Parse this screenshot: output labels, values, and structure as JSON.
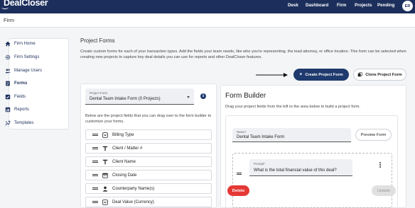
{
  "app": {
    "logo_text": "DealCloser"
  },
  "nav": {
    "items": [
      {
        "label": "Desk"
      },
      {
        "label": "Dashboard"
      },
      {
        "label": "Firm"
      },
      {
        "label": "Projects"
      },
      {
        "label": "Pending"
      }
    ],
    "avatar_initials": "ER"
  },
  "breadcrumb": {
    "label": "Firm"
  },
  "sidebar": {
    "items": [
      {
        "label": "Firm Home",
        "icon": "home-icon"
      },
      {
        "label": "Firm Settings",
        "icon": "gear-icon"
      },
      {
        "label": "Manage Users",
        "icon": "users-icon"
      },
      {
        "label": "Forms",
        "icon": "forms-icon",
        "active": true
      },
      {
        "label": "Fields",
        "icon": "checkbox-icon"
      },
      {
        "label": "Reports",
        "icon": "bar-chart-icon"
      },
      {
        "label": "Templates",
        "icon": "templates-icon"
      }
    ]
  },
  "main": {
    "title": "Project Forms",
    "description": "Create custom forms for each of your transaction types. Add the fields your team needs, like who you're representing, the lead attorney, or office location. This form can be selected when creating new projects to capture key deal details you can use for reports and other DealCloser features.",
    "create_button": "Create Project Form",
    "clone_button": "Clone Project Form"
  },
  "left_panel": {
    "select_label": "Project Form",
    "select_value": "Dental Team Intake Form (0 Projects)",
    "hint": "Below are the project fields that you can drag over to the form builder to customize your forms.",
    "fields": [
      {
        "label": "Billing Type",
        "icon": "dropdown-icon"
      },
      {
        "label": "Client / Matter #",
        "icon": "text-icon"
      },
      {
        "label": "Client Name",
        "icon": "text-icon"
      },
      {
        "label": "Closing Date",
        "icon": "calendar-icon"
      },
      {
        "label": "Counterparty Name(s)",
        "icon": "person-icon"
      },
      {
        "label": "Deal Value (Currency)",
        "icon": "dropdown-icon"
      }
    ]
  },
  "form_builder": {
    "title": "Form Builder",
    "hint": "Drag your project fields from the left to the area below to build a project form.",
    "name_label": "Name*",
    "name_value": "Dental Team Intake Form",
    "preview_button": "Preview Form",
    "prompt_label": "Prompt*",
    "prompt_value": "What is the total financial value of this deal?",
    "delete_button": "Delete",
    "update_button": "Update"
  },
  "colors": {
    "navy": "#1c2f5c",
    "primary_button": "#1e3a6e",
    "danger": "#e53935"
  }
}
